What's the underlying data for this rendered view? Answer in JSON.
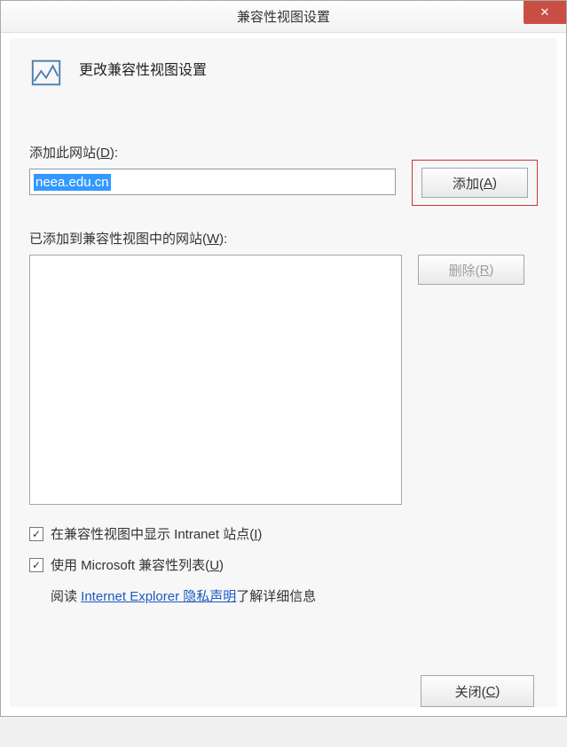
{
  "titlebar": {
    "title": "兼容性视图设置",
    "close": "✕"
  },
  "header": {
    "title": "更改兼容性视图设置"
  },
  "addSite": {
    "label_pre": "添加此网站(",
    "label_key": "D",
    "label_post": "):",
    "value": "neea.edu.cn",
    "button_pre": "添加(",
    "button_key": "A",
    "button_post": ")"
  },
  "addedList": {
    "label_pre": "已添加到兼容性视图中的网站(",
    "label_key": "W",
    "label_post": "):",
    "remove_pre": "删除(",
    "remove_key": "R",
    "remove_post": ")"
  },
  "options": {
    "intranet_pre": "在兼容性视图中显示 Intranet 站点(",
    "intranet_key": "I",
    "intranet_post": ")",
    "mslist_pre": "使用 Microsoft 兼容性列表(",
    "mslist_key": "U",
    "mslist_post": ")"
  },
  "privacy": {
    "pre": "阅读 ",
    "link": "Internet Explorer 隐私声明",
    "post": "了解详细信息"
  },
  "footer": {
    "close_pre": "关闭(",
    "close_key": "C",
    "close_post": ")"
  }
}
